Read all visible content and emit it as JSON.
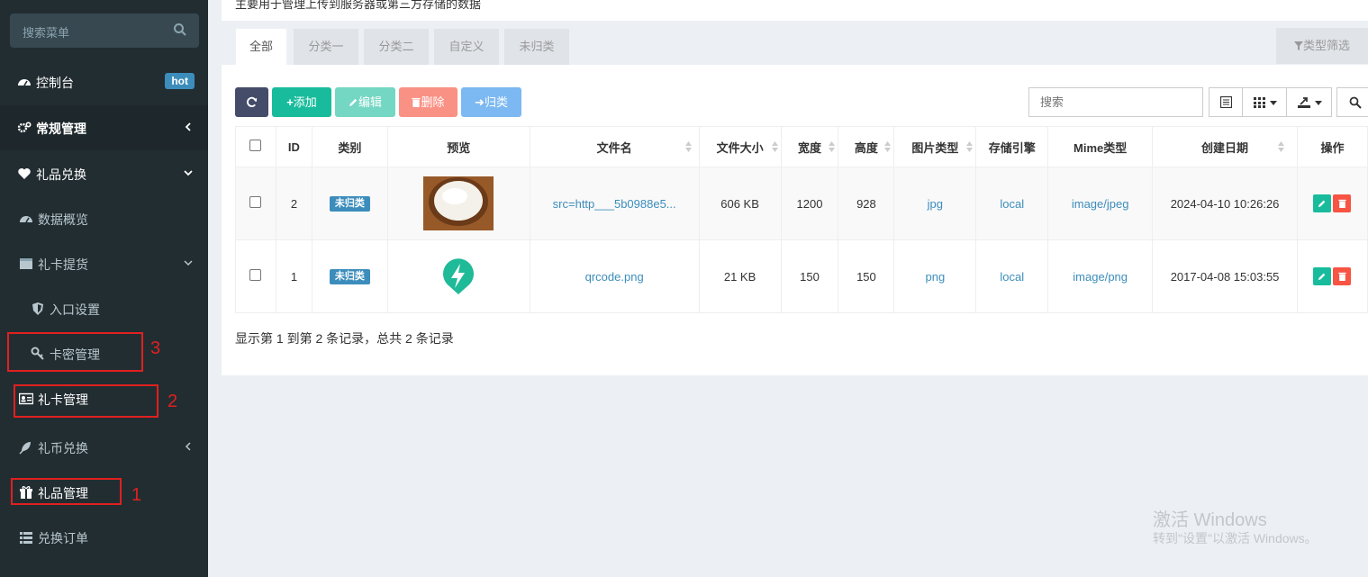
{
  "sidebar": {
    "search_placeholder": "搜索菜单",
    "items": [
      {
        "label": "控制台",
        "badge": "hot"
      },
      {
        "label": "常规管理"
      },
      {
        "label": "礼品兑换"
      },
      {
        "label": "数据概览"
      },
      {
        "label": "礼卡提货"
      },
      {
        "label": "入口设置"
      },
      {
        "label": "卡密管理"
      },
      {
        "label": "礼卡管理"
      },
      {
        "label": "礼币兑换"
      },
      {
        "label": "礼品管理"
      },
      {
        "label": "兑换订单"
      }
    ],
    "annotations": [
      "3",
      "2",
      "1"
    ]
  },
  "page": {
    "description": "主要用于管理上传到服务器或第三方存储的数据",
    "tabs": [
      "全部",
      "分类一",
      "分类二",
      "自定义",
      "未归类"
    ],
    "filter_label": "类型筛选"
  },
  "toolbar": {
    "add": "添加",
    "edit": "编辑",
    "delete": "删除",
    "classify": "归类",
    "search_placeholder": "搜索"
  },
  "table": {
    "columns": [
      "ID",
      "类别",
      "预览",
      "文件名",
      "文件大小",
      "宽度",
      "高度",
      "图片类型",
      "存储引擎",
      "Mime类型",
      "创建日期",
      "操作"
    ],
    "rows": [
      {
        "id": "2",
        "category": "未归类",
        "filename": "src=http___5b0988e5...",
        "size": "606 KB",
        "width": "1200",
        "height": "928",
        "type": "jpg",
        "storage": "local",
        "mime": "image/jpeg",
        "created": "2024-04-10 10:26:26"
      },
      {
        "id": "1",
        "category": "未归类",
        "filename": "qrcode.png",
        "size": "21 KB",
        "width": "150",
        "height": "150",
        "type": "png",
        "storage": "local",
        "mime": "image/png",
        "created": "2017-04-08 15:03:55"
      }
    ]
  },
  "footer": {
    "summary": "显示第 1 到第 2 条记录，总共 2 条记录"
  },
  "watermark": {
    "title": "激活 Windows",
    "subtitle": "转到\"设置\"以激活 Windows。"
  },
  "colors": {
    "sidebar_bg": "#222d32",
    "primary": "#3c8dbc",
    "success": "#18bc9c",
    "danger": "#f75444",
    "info": "#5dade2",
    "dark": "#444c69"
  }
}
